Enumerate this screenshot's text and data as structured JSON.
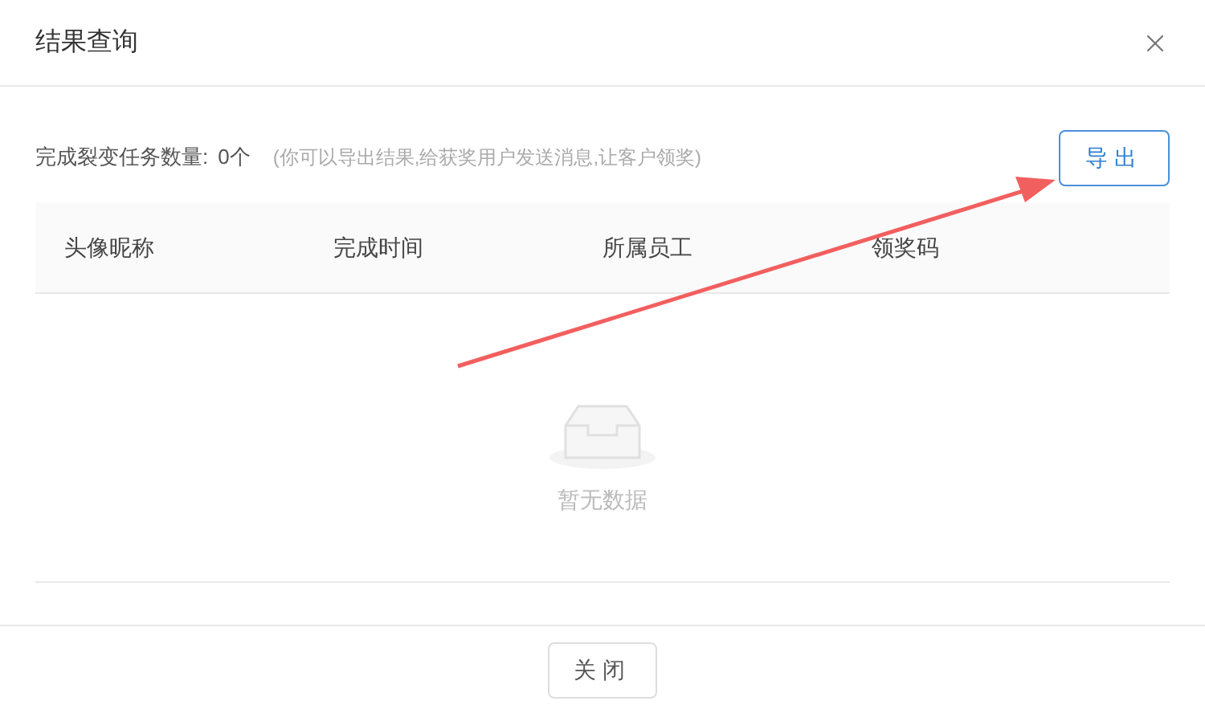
{
  "dialog": {
    "title": "结果查询"
  },
  "summary": {
    "label": "完成裂变任务数量:",
    "count": "0个",
    "hint": "(你可以导出结果,给获奖用户发送消息,让客户领奖)"
  },
  "export_button": "导出",
  "table": {
    "columns": [
      "头像昵称",
      "完成时间",
      "所属员工",
      "领奖码"
    ],
    "empty_text": "暂无数据"
  },
  "footer_button": "关闭"
}
